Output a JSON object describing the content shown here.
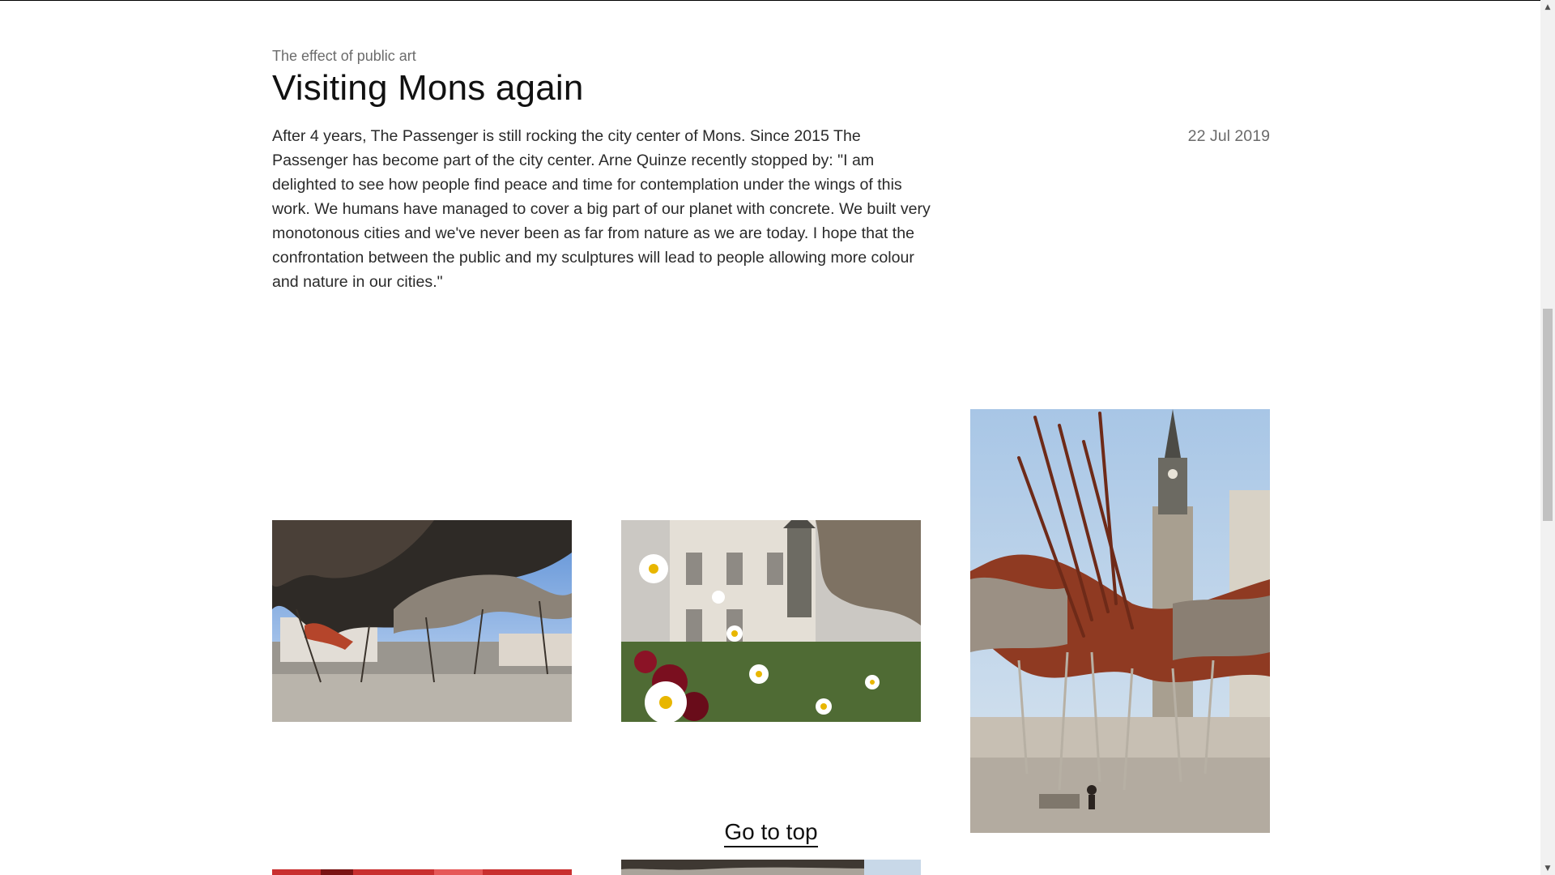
{
  "article": {
    "eyebrow": "The effect of public art",
    "title": "Visiting Mons again",
    "body": "After 4 years, The Passenger is still rocking the city center of Mons. Since 2015 The Passenger has become part of the city center. Arne Quinze recently stopped by: \"I am delighted to see how people find peace and time for contemplation under the wings of this work. We humans have managed to cover a big part of our planet with concrete. We built very monotonous cities and we've never been as far from nature as we are today. I hope that the confrontation between the public and my sculptures will lead to people allowing more colour and nature in our cities.\"",
    "date": "22 Jul 2019"
  },
  "gallery": {
    "images": [
      {
        "subject": "Wooden sculpture canopy over square, low angle"
      },
      {
        "subject": "Daisies and flowers in front of sculpture and tower"
      },
      {
        "subject": "Red wooden sculpture with belfry tower behind"
      },
      {
        "subject": "Red wooden structure close-up"
      },
      {
        "subject": "Wooden structure detail"
      }
    ]
  },
  "navigation": {
    "go_to_top": "Go to top"
  },
  "scrollbar": {
    "up_icon": "chevron-up-icon",
    "down_icon": "chevron-down-icon"
  },
  "colors": {
    "text": "#111111",
    "muted": "#6b6b6b",
    "scrollbar_track": "#f1f1f1",
    "scrollbar_thumb": "#c1c1c1"
  }
}
